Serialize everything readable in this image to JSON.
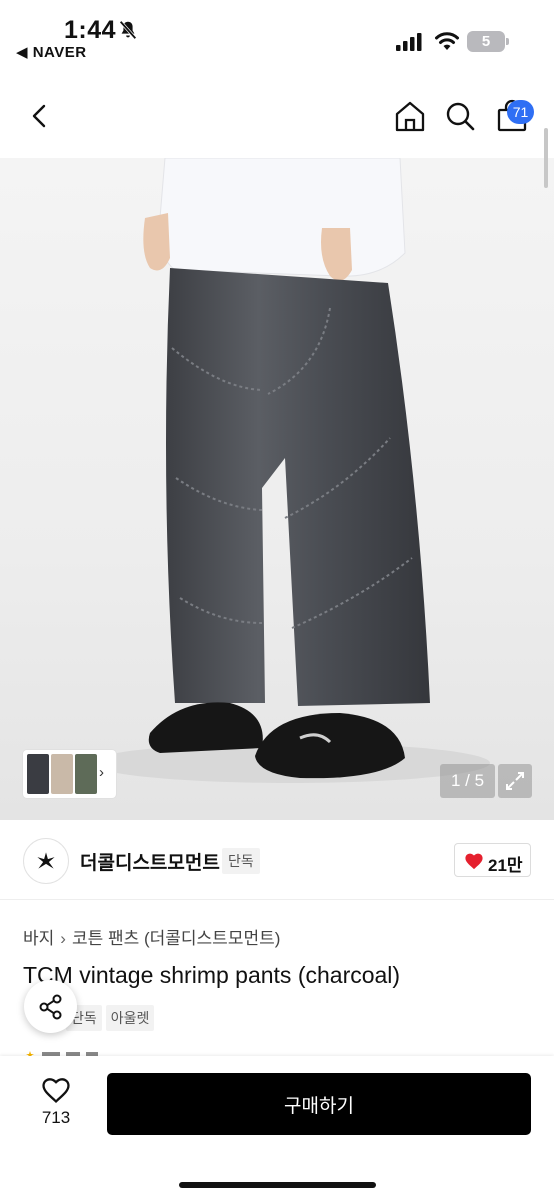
{
  "status_bar": {
    "time": "1:44",
    "back_app": "◀ NAVER",
    "battery_level": "5"
  },
  "header": {
    "cart_count": "71"
  },
  "gallery": {
    "counter": "1 / 5"
  },
  "brand": {
    "name": "더콜디스트모먼트",
    "tag": "단독",
    "likes": "21만"
  },
  "product": {
    "breadcrumb": [
      "바지",
      "코튼 팬츠 (더콜디스트모먼트)"
    ],
    "title": "TCM vintage shrimp pants (charcoal)",
    "tags": [
      "단독",
      "아울렛"
    ]
  },
  "bottom_bar": {
    "wish_count": "713",
    "buy_label": "구매하기"
  },
  "colors": {
    "accent_badge": "#2f6ff4",
    "buy_button": "#000000",
    "heart": "#e5202e"
  }
}
